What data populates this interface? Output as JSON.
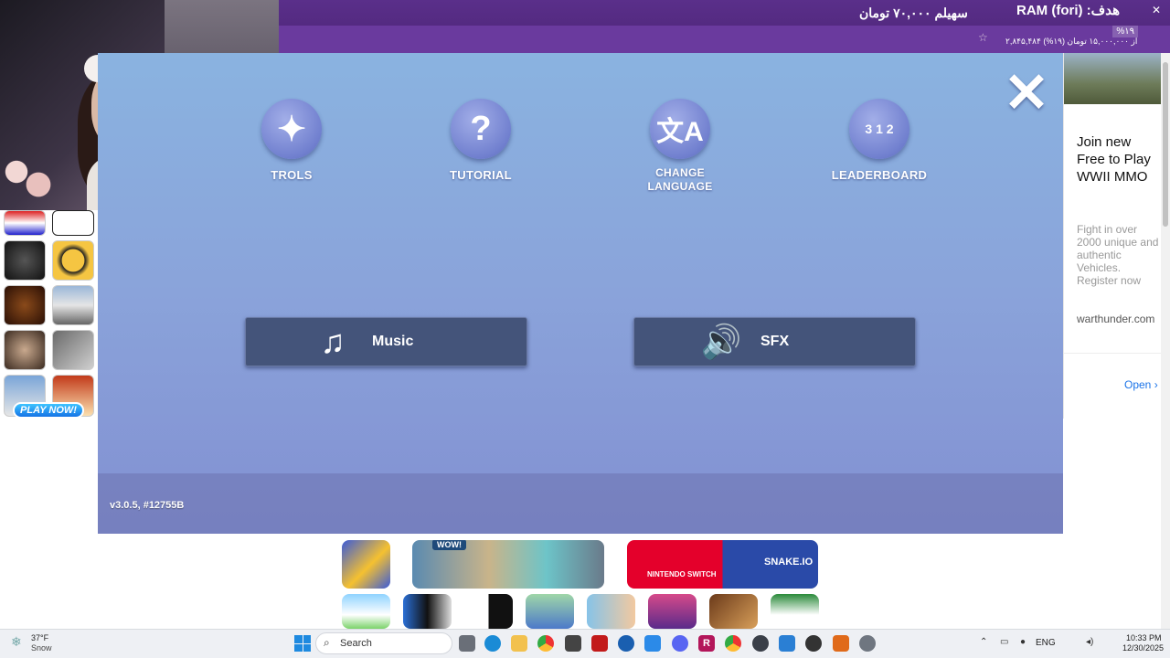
{
  "overlay": {
    "goal": "RAM (fori) :هدف",
    "donor": "سهیلم ۷۰,۰۰۰ تومان",
    "progress_percent": "%۱۹",
    "progress_amount": "۲,۸۴۵,۴۸۴ از ۱۵,۰۰۰,۰۰۰ تومان (۱۹%)"
  },
  "game": {
    "menu": [
      {
        "label": "TROLS",
        "icon": "gamepad-icon"
      },
      {
        "label": "TUTORIAL",
        "icon": "question-icon"
      },
      {
        "label": "CHANGE\nLANGUAGE",
        "icon": "translate-icon"
      },
      {
        "label": "LEADERBOARD",
        "icon": "podium-icon"
      }
    ],
    "music_label": "Music",
    "sfx_label": "SFX",
    "version": "v3.0.5, #12755B"
  },
  "left_promo": {
    "play_now": "PLAY NOW!"
  },
  "ad": {
    "title": "Join new Free to Play WWII MMO",
    "description": "Fight in over 2000 unique and authentic Vehicles. Register now",
    "url": "warthunder.com",
    "open_label": "Open"
  },
  "bottom_games": {
    "wow_label": "WOW!",
    "snake_label": "SNAKE.IO",
    "nintendo_label": "NINTENDO SWITCH"
  },
  "taskbar": {
    "weather_temp": "37°F",
    "weather_desc": "Snow",
    "search_label": "Search",
    "language": "ENG",
    "time": "10:33 PM",
    "date": "12/30/2025"
  }
}
